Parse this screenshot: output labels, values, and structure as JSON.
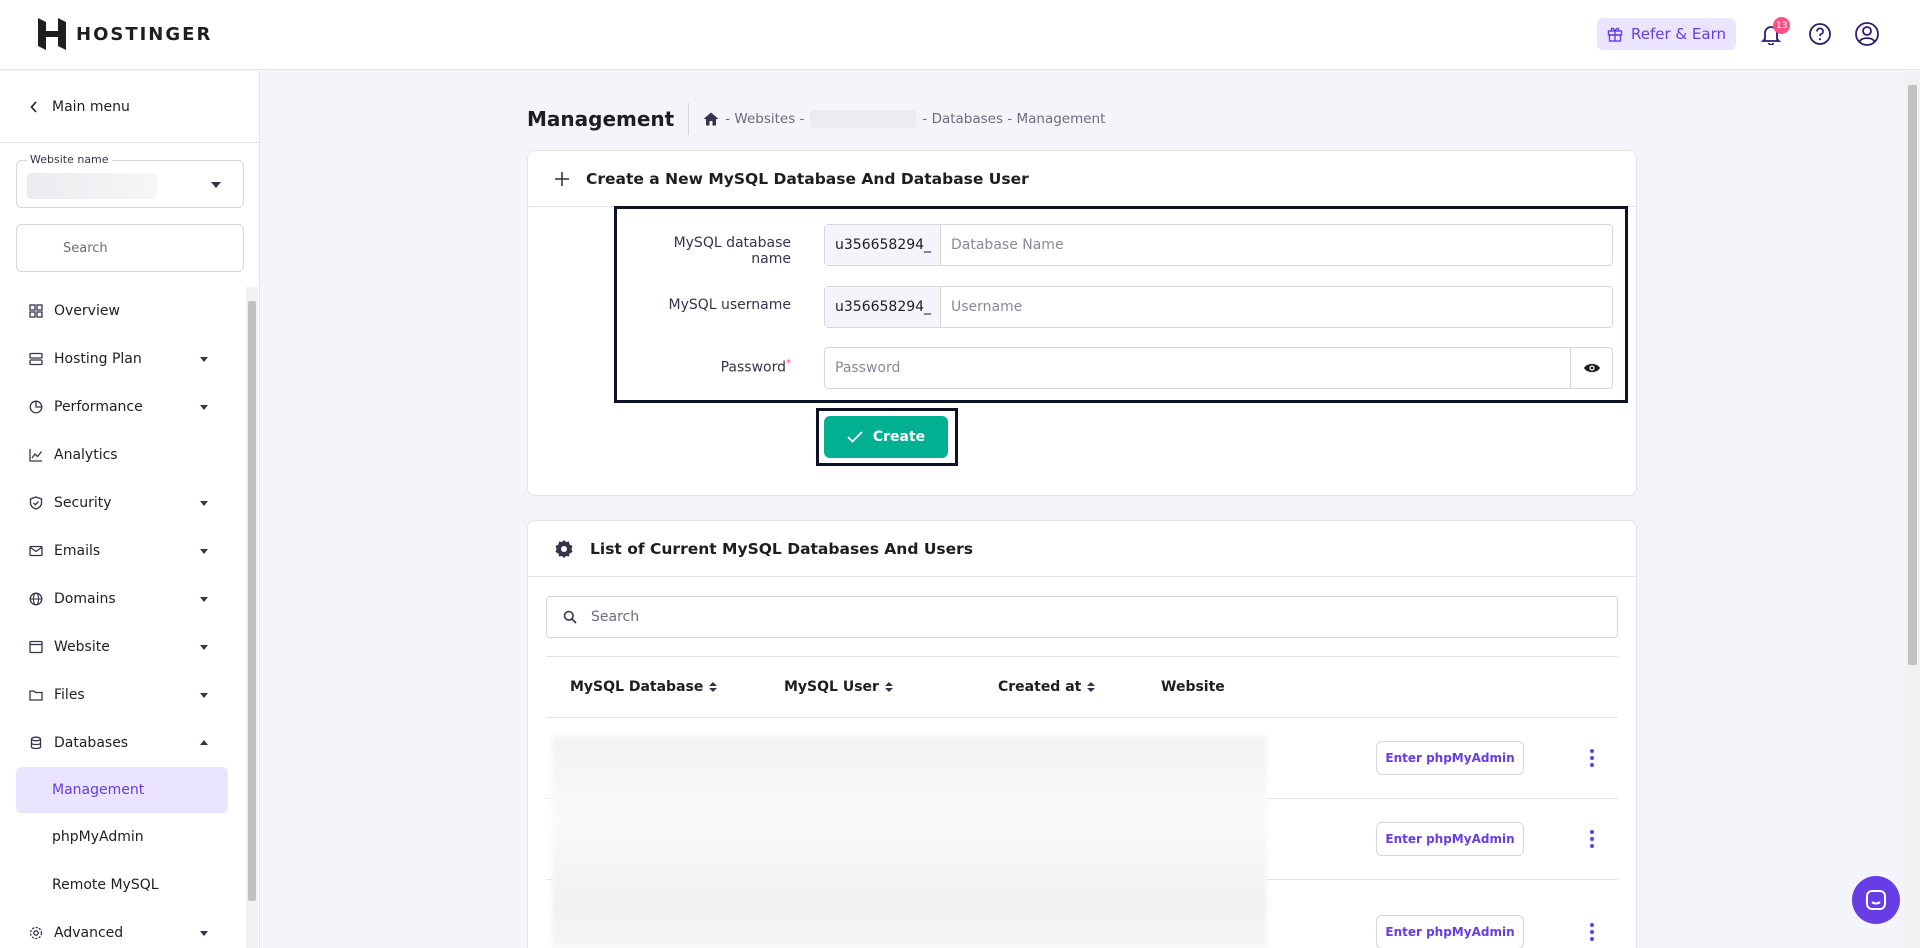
{
  "header": {
    "brand": "HOSTINGER",
    "refer_label": "Refer & Earn",
    "notification_count": "13",
    "colors": {
      "accent": "#673de6",
      "green": "#00b090"
    }
  },
  "sidebar": {
    "main_menu": "Main menu",
    "website_select_label": "Website name",
    "search_placeholder": "Search",
    "items": [
      {
        "label": "Overview",
        "icon": "grid-icon"
      },
      {
        "label": "Hosting Plan",
        "icon": "server-icon"
      },
      {
        "label": "Performance",
        "icon": "pie-chart-icon"
      },
      {
        "label": "Analytics",
        "icon": "trend-icon"
      },
      {
        "label": "Security",
        "icon": "shield-icon"
      },
      {
        "label": "Emails",
        "icon": "mail-icon"
      },
      {
        "label": "Domains",
        "icon": "globe-icon"
      },
      {
        "label": "Website",
        "icon": "browser-icon"
      },
      {
        "label": "Files",
        "icon": "folder-icon"
      },
      {
        "label": "Databases",
        "icon": "database-icon"
      }
    ],
    "sub_items": [
      "Management",
      "phpMyAdmin",
      "Remote MySQL"
    ],
    "advanced": "Advanced"
  },
  "page": {
    "title": "Management",
    "breadcrumb": [
      "- Websites -",
      "- Databases - Management"
    ]
  },
  "create_card": {
    "title": "Create a New MySQL Database And Database User",
    "db_name_label": "MySQL database name",
    "db_prefix": "u356658294_",
    "db_name_placeholder": "Database Name",
    "username_label": "MySQL username",
    "user_prefix": "u356658294_",
    "username_placeholder": "Username",
    "password_label": "Password",
    "password_required": "*",
    "password_placeholder": "Password",
    "create_label": "Create"
  },
  "list_card": {
    "title": "List of Current MySQL Databases And Users",
    "search_placeholder": "Search",
    "columns": [
      "MySQL Database",
      "MySQL User",
      "Created at",
      "Website"
    ],
    "row_action": "Enter phpMyAdmin"
  }
}
